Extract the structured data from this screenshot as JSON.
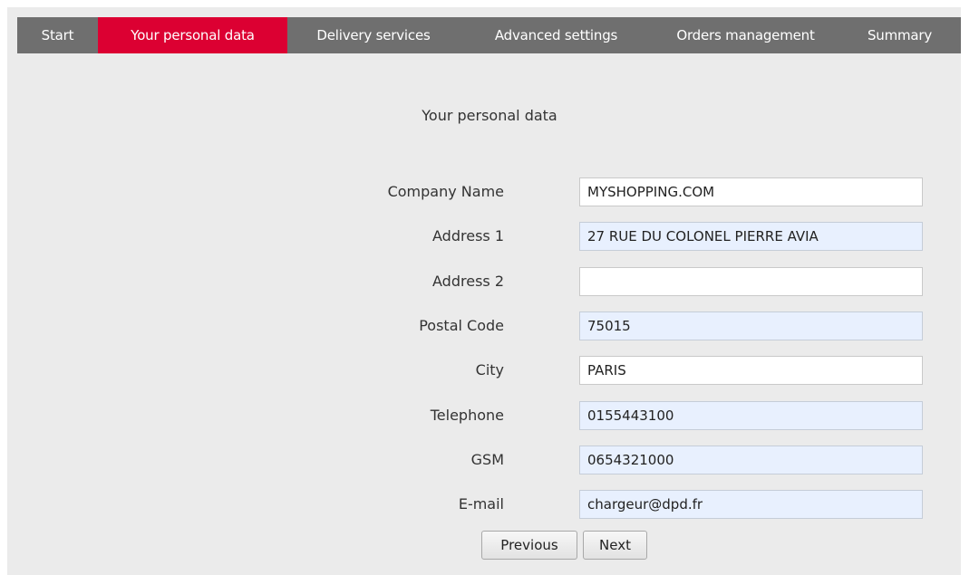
{
  "tabs": [
    {
      "label": "Start",
      "active": false
    },
    {
      "label": "Your personal data",
      "active": true
    },
    {
      "label": "Delivery services",
      "active": false
    },
    {
      "label": "Advanced settings",
      "active": false
    },
    {
      "label": "Orders management",
      "active": false
    },
    {
      "label": "Summary",
      "active": false
    }
  ],
  "colors": {
    "tab_bar": "#6f6f6f",
    "tab_active": "#dc0032",
    "page_background": "#ebebeb",
    "autofill_background": "#e8f0fe"
  },
  "section_title": "Your personal data",
  "form": {
    "company_name": {
      "label": "Company Name",
      "value": "MYSHOPPING.COM"
    },
    "address1": {
      "label": "Address 1",
      "value": "27 RUE DU COLONEL PIERRE AVIA"
    },
    "address2": {
      "label": "Address 2",
      "value": ""
    },
    "postal_code": {
      "label": "Postal Code",
      "value": "75015"
    },
    "city": {
      "label": "City",
      "value": "PARIS"
    },
    "telephone": {
      "label": "Telephone",
      "value": "0155443100"
    },
    "gsm": {
      "label": "GSM",
      "value": "0654321000"
    },
    "email": {
      "label": "E-mail",
      "value": "chargeur@dpd.fr"
    }
  },
  "buttons": {
    "previous": "Previous",
    "next": "Next"
  }
}
